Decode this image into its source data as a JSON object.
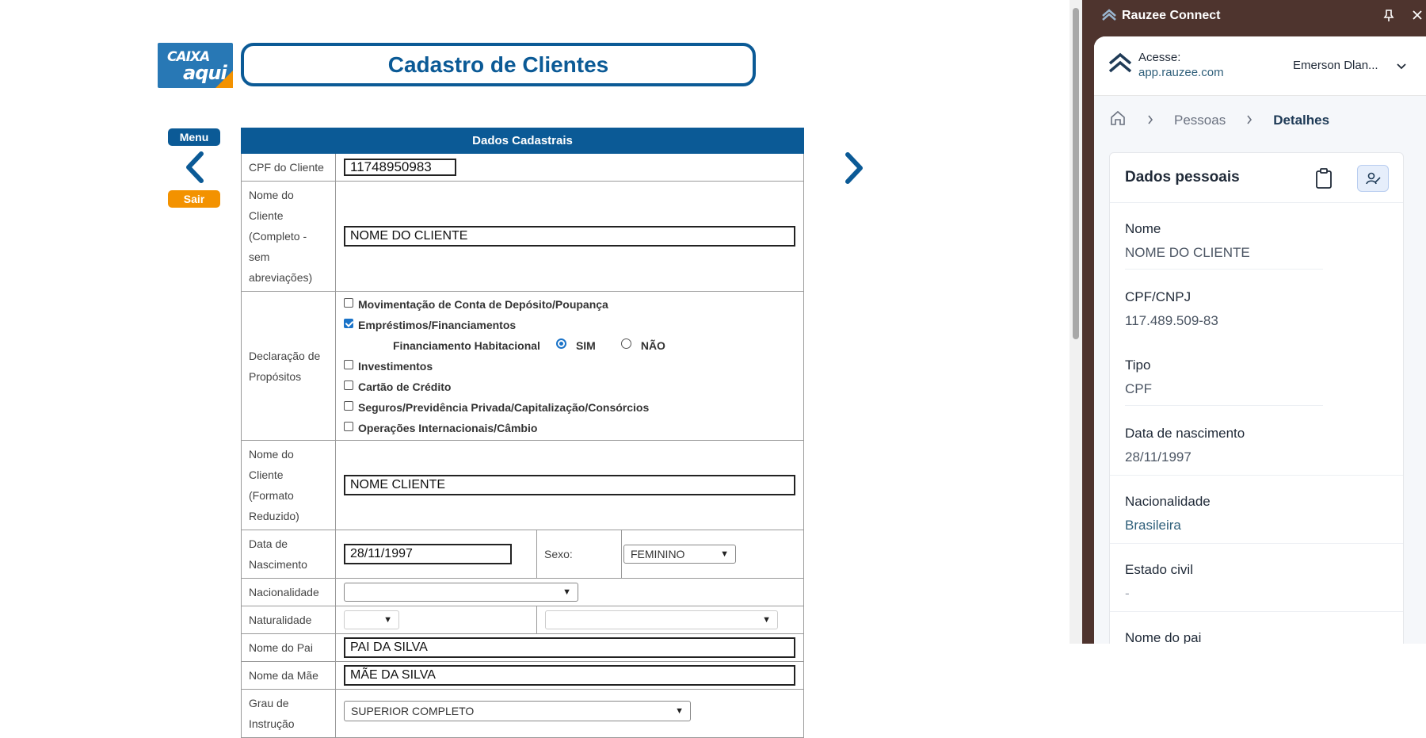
{
  "app": {
    "logo_line1": "CAIXA",
    "logo_line2": "aqui",
    "title": "Cadastro de Clientes",
    "nav_menu": "Menu",
    "nav_sair": "Sair"
  },
  "form": {
    "header": "Dados Cadastrais",
    "cpf_label": "CPF do Cliente",
    "cpf_value": "11748950983",
    "nome_label": "Nome do Cliente (Completo - sem abreviações)",
    "nome_value": "NOME DO CLIENTE",
    "declaracao_label": "Declaração de Propósitos",
    "propositos": [
      {
        "label": "Movimentação de Conta de Depósito/Poupança",
        "checked": false
      },
      {
        "label": "Empréstimos/Financiamentos",
        "checked": true
      },
      {
        "label": "Investimentos",
        "checked": false
      },
      {
        "label": "Cartão de Crédito",
        "checked": false
      },
      {
        "label": "Seguros/Previdência Privada/Capitalização/Consórcios",
        "checked": false
      },
      {
        "label": "Operações Internacionais/Câmbio",
        "checked": false
      }
    ],
    "financiamento_label": "Financiamento Habitacional",
    "radio_sim": "SIM",
    "radio_nao": "NÃO",
    "nome_reduzido_label": "Nome do Cliente (Formato Reduzido)",
    "nome_reduzido_value": "NOME  CLIENTE",
    "nascimento_label": "Data de Nascimento",
    "nascimento_value": "28/11/1997",
    "sexo_label": "Sexo:",
    "sexo_value": "FEMININO",
    "nacionalidade_label": "Nacionalidade",
    "nacionalidade_value": "",
    "naturalidade_label": "Naturalidade",
    "naturalidade_uf": "",
    "naturalidade_cidade": "",
    "pai_label": "Nome do Pai",
    "pai_value": "PAI DA SILVA",
    "mae_label": "Nome da Mãe",
    "mae_value": "MÃE DA SILVA",
    "grau_label": "Grau de Instrução",
    "grau_value": "SUPERIOR COMPLETO"
  },
  "panel": {
    "title": "Rauzee Connect",
    "access_label": "Acesse:",
    "access_url": "app.rauzee.com",
    "user": "Emerson Dlan...",
    "breadcrumb": [
      "Pessoas",
      "Detalhes"
    ],
    "section_title": "Dados pessoais",
    "fields": [
      {
        "label": "Nome",
        "value": "NOME DO CLIENTE"
      },
      {
        "label": "CPF/CNPJ",
        "value": "117.489.509-83"
      },
      {
        "label": "Tipo",
        "value": "CPF"
      },
      {
        "label": "Data de nascimento",
        "value": "28/11/1997"
      },
      {
        "label": "Nacionalidade",
        "value": "Brasileira"
      },
      {
        "label": "Estado civil",
        "value": "-"
      },
      {
        "label": "Nome do pai",
        "value": ""
      }
    ],
    "link_color": "#2f5f7a"
  }
}
